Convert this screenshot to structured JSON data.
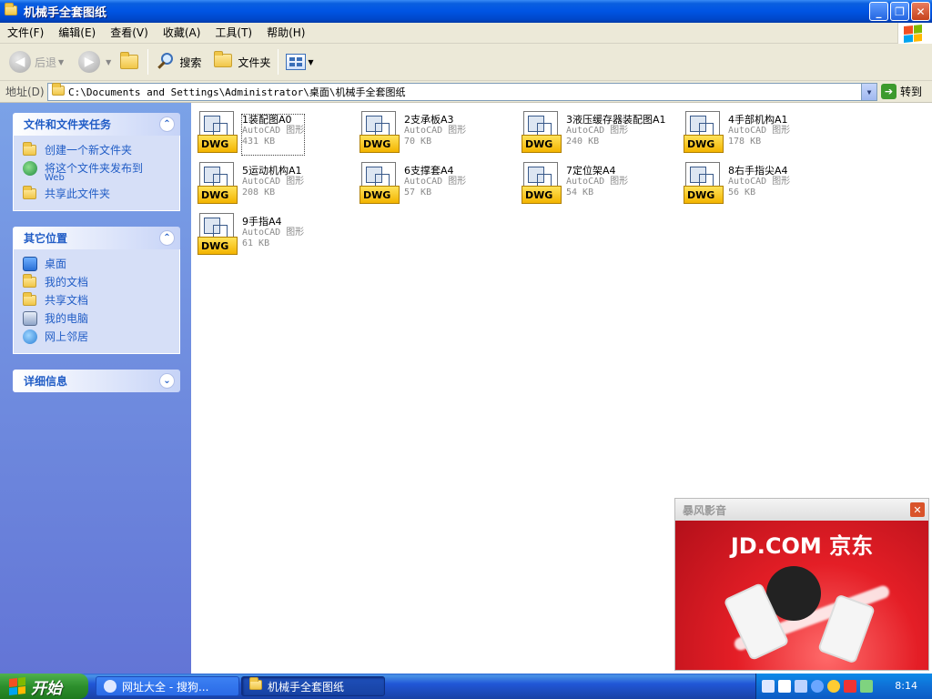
{
  "window": {
    "title": "机械手全套图纸",
    "minimize": "_",
    "restore": "❐",
    "close": "✕"
  },
  "menu": [
    "文件(F)",
    "编辑(E)",
    "查看(V)",
    "收藏(A)",
    "工具(T)",
    "帮助(H)"
  ],
  "toolbar": {
    "back": "后退",
    "search": "搜索",
    "folders": "文件夹"
  },
  "address": {
    "label": "地址(D)",
    "path": "C:\\Documents and Settings\\Administrator\\桌面\\机械手全套图纸",
    "go": "转到"
  },
  "panels": {
    "tasks": {
      "title": "文件和文件夹任务",
      "items": [
        "创建一个新文件夹",
        "将这个文件夹发布到",
        "共享此文件夹"
      ],
      "web_sub": "Web"
    },
    "places": {
      "title": "其它位置",
      "items": [
        "桌面",
        "我的文档",
        "共享文档",
        "我的电脑",
        "网上邻居"
      ]
    },
    "details": {
      "title": "详细信息"
    }
  },
  "file_type": "AutoCAD 图形",
  "dwg_badge": "DWG",
  "files": [
    {
      "name": "1装配图A0",
      "size": "431 KB"
    },
    {
      "name": "2支承板A3",
      "size": "70 KB"
    },
    {
      "name": "3液压缓存器装配图A1",
      "size": "240 KB"
    },
    {
      "name": "4手部机构A1",
      "size": "178 KB"
    },
    {
      "name": "5运动机构A1",
      "size": "208 KB"
    },
    {
      "name": "6支撑套A4",
      "size": "57 KB"
    },
    {
      "name": "7定位架A4",
      "size": "54 KB"
    },
    {
      "name": "8右手指尖A4",
      "size": "56 KB"
    },
    {
      "name": "9手指A4",
      "size": "61 KB"
    }
  ],
  "ad": {
    "header": "暴风影音",
    "brand": "JD.COM 京东",
    "close": "✕"
  },
  "taskbar": {
    "start": "开始",
    "tasks": [
      "网址大全 - 搜狗...",
      "机械手全套图纸"
    ],
    "clock": "8:14"
  },
  "colors": {
    "title_blue": "#0054e3",
    "pane_link": "#215dc6",
    "ad_red": "#e41e26",
    "dwg_yellow": "#f3b400"
  }
}
